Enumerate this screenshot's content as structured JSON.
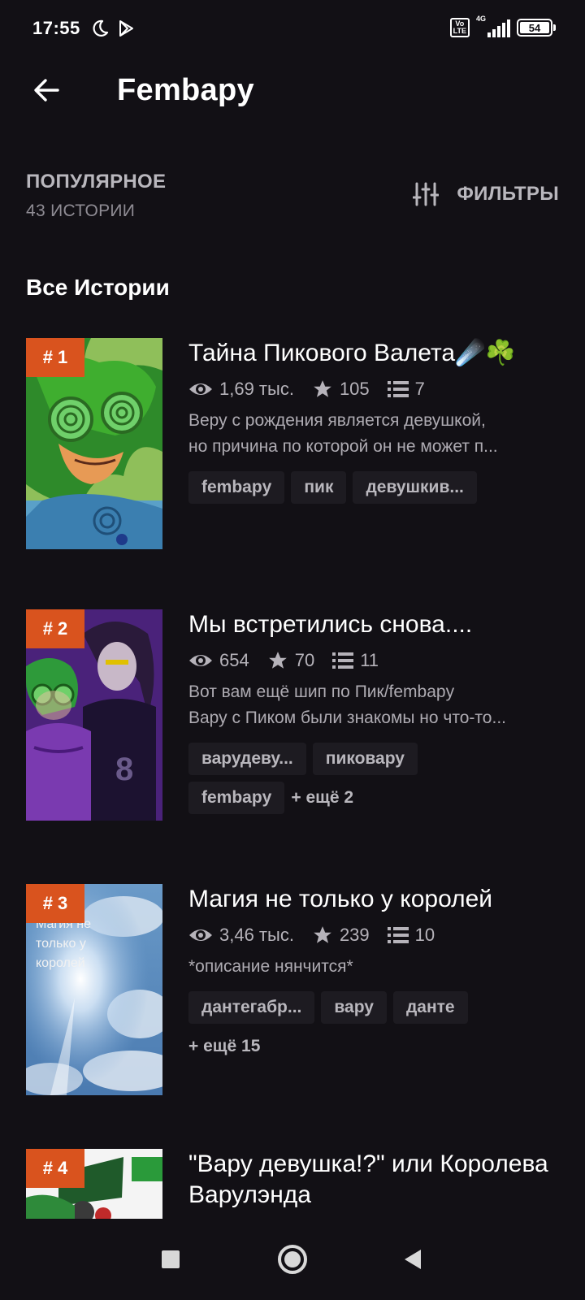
{
  "status_bar": {
    "time": "17:55",
    "volte": "Vo\nLTE",
    "network": "4G",
    "battery": "54"
  },
  "app_bar": {
    "title": "Fembapy"
  },
  "sort": {
    "label": "ПОПУЛЯРНОЕ",
    "count": "43 ИСТОРИИ"
  },
  "filters": {
    "label": "ФИЛЬТРЫ"
  },
  "section": {
    "title": "Все Истории"
  },
  "stories": [
    {
      "rank": "# 1",
      "title": "Тайна Пикового Валета☄️☘️",
      "reads": "1,69 тыс.",
      "votes": "105",
      "parts": "7",
      "desc_lines": [
        "Веру с рождения является девушкой,",
        "но причина по которой он не может п..."
      ],
      "tags": [
        "fembapy",
        "пик",
        "девушкив..."
      ],
      "more": ""
    },
    {
      "rank": "# 2",
      "title": "Мы встретились снова....",
      "reads": "654",
      "votes": "70",
      "parts": "11",
      "desc_lines": [
        "Вот вам ещё шип по Пик/fembapy",
        "Вару с Пиком были знакомы но что-то..."
      ],
      "tags": [
        "варудеву...",
        "пиковару",
        "fembapy"
      ],
      "more": "+ ещё 2"
    },
    {
      "rank": "# 3",
      "title": "Магия не только у королей",
      "reads": "3,46 тыс.",
      "votes": "239",
      "parts": "10",
      "desc_lines": [
        "*описание нянчится*"
      ],
      "tags": [
        "дантегабр...",
        "вару",
        "данте"
      ],
      "more": "+ ещё 15",
      "cover_text": "Магия не только у королей"
    },
    {
      "rank": "# 4",
      "title": "\"Вару девушка!?\" или Королева Варулэнда"
    }
  ],
  "colors": {
    "background": "#121015",
    "accent_rank": "#d9531e",
    "muted_text": "#b9b7bd",
    "tag_bg": "#1d1b21"
  }
}
